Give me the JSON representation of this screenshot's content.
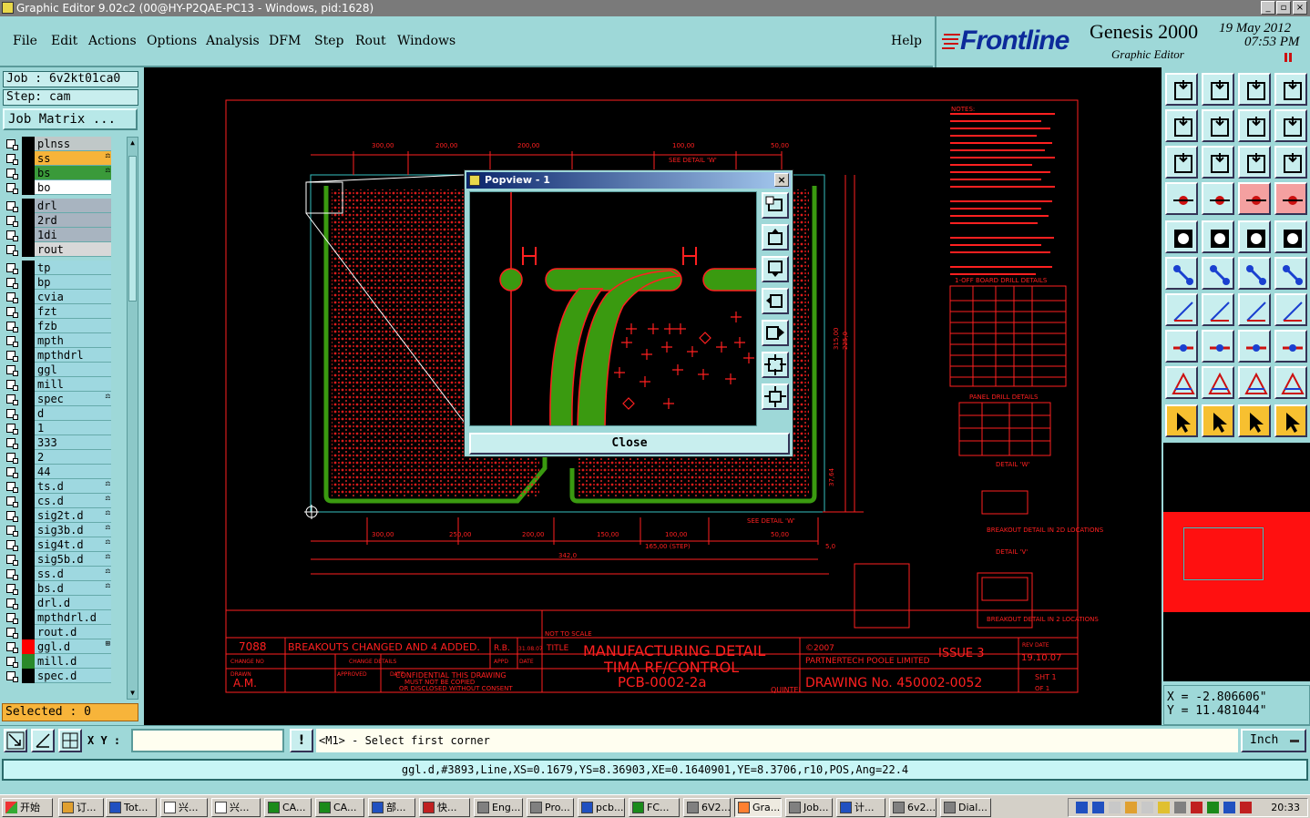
{
  "window": {
    "title": "Graphic Editor 9.02c2 (00@HY-P2QAE-PC13 - Windows, pid:1628)"
  },
  "menu": {
    "items": [
      "File",
      "Edit",
      "Actions",
      "Options",
      "Analysis",
      "DFM",
      "Step",
      "Rout",
      "Windows"
    ],
    "help": "Help"
  },
  "brand": {
    "logo": "Frontline",
    "product": "Genesis 2000",
    "subtitle": "Graphic Editor",
    "date": "19 May 2012",
    "time": "07:53 PM"
  },
  "job": {
    "job_label": "Job : 6v2kt01ca0",
    "step_label": "Step: cam",
    "matrix_button": "Job Matrix ..."
  },
  "layers": [
    {
      "name": "plnss",
      "color": "#000000",
      "bg": "#c0c8c8",
      "mark": ""
    },
    {
      "name": "ss",
      "color": "#000000",
      "bg": "#f7b43a",
      "mark": "⚖"
    },
    {
      "name": "bs",
      "color": "#000000",
      "bg": "#3a9a3a",
      "mark": "⚖"
    },
    {
      "name": "bo",
      "color": "#000000",
      "bg": "#ffffff",
      "mark": ""
    },
    {
      "name": "drl",
      "color": "#000000",
      "bg": "#a8b4c0",
      "mark": ""
    },
    {
      "name": "2rd",
      "color": "#000000",
      "bg": "#a8b4c0",
      "mark": ""
    },
    {
      "name": "1di",
      "color": "#000000",
      "bg": "#a8b4c0",
      "mark": ""
    },
    {
      "name": "rout",
      "color": "#000000",
      "bg": "#d8d8d8",
      "mark": ""
    },
    {
      "name": "tp",
      "color": "#000000",
      "bg": "#9ed8e0",
      "mark": ""
    },
    {
      "name": "bp",
      "color": "#000000",
      "bg": "#9ed8e0",
      "mark": ""
    },
    {
      "name": "cvia",
      "color": "#000000",
      "bg": "#9ed8e0",
      "mark": ""
    },
    {
      "name": "fzt",
      "color": "#000000",
      "bg": "#9ed8e0",
      "mark": ""
    },
    {
      "name": "fzb",
      "color": "#000000",
      "bg": "#9ed8e0",
      "mark": ""
    },
    {
      "name": "mpth",
      "color": "#000000",
      "bg": "#9ed8e0",
      "mark": ""
    },
    {
      "name": "mpthdrl",
      "color": "#000000",
      "bg": "#9ed8e0",
      "mark": ""
    },
    {
      "name": "ggl",
      "color": "#000000",
      "bg": "#9ed8e0",
      "mark": ""
    },
    {
      "name": "mill",
      "color": "#000000",
      "bg": "#9ed8e0",
      "mark": ""
    },
    {
      "name": "spec",
      "color": "#000000",
      "bg": "#9ed8e0",
      "mark": "⚖"
    },
    {
      "name": "d",
      "color": "#000000",
      "bg": "#9ed8e0",
      "mark": ""
    },
    {
      "name": "1",
      "color": "#000000",
      "bg": "#9ed8e0",
      "mark": ""
    },
    {
      "name": "333",
      "color": "#000000",
      "bg": "#9ed8e0",
      "mark": ""
    },
    {
      "name": "2",
      "color": "#000000",
      "bg": "#9ed8e0",
      "mark": ""
    },
    {
      "name": "44",
      "color": "#000000",
      "bg": "#9ed8e0",
      "mark": ""
    },
    {
      "name": "ts.d",
      "color": "#000000",
      "bg": "#9ed8e0",
      "mark": "⚖"
    },
    {
      "name": "cs.d",
      "color": "#000000",
      "bg": "#9ed8e0",
      "mark": "⚖"
    },
    {
      "name": "sig2t.d",
      "color": "#000000",
      "bg": "#9ed8e0",
      "mark": "⚖"
    },
    {
      "name": "sig3b.d",
      "color": "#000000",
      "bg": "#9ed8e0",
      "mark": "⚖"
    },
    {
      "name": "sig4t.d",
      "color": "#000000",
      "bg": "#9ed8e0",
      "mark": "⚖"
    },
    {
      "name": "sig5b.d",
      "color": "#000000",
      "bg": "#9ed8e0",
      "mark": "⚖"
    },
    {
      "name": "ss.d",
      "color": "#000000",
      "bg": "#9ed8e0",
      "mark": "⚖"
    },
    {
      "name": "bs.d",
      "color": "#000000",
      "bg": "#9ed8e0",
      "mark": "⚖"
    },
    {
      "name": "drl.d",
      "color": "#000000",
      "bg": "#9ed8e0",
      "mark": ""
    },
    {
      "name": "mpthdrl.d",
      "color": "#000000",
      "bg": "#9ed8e0",
      "mark": ""
    },
    {
      "name": "rout.d",
      "color": "#000000",
      "bg": "#9ed8e0",
      "mark": ""
    },
    {
      "name": "ggl.d",
      "color": "#ff0000",
      "bg": "#9ed8e0",
      "mark": "⊞"
    },
    {
      "name": "mill.d",
      "color": "#2a8a2a",
      "bg": "#9ed8e0",
      "mark": ""
    },
    {
      "name": "spec.d",
      "color": "#000000",
      "bg": "#9ed8e0",
      "mark": ""
    }
  ],
  "selected": {
    "label": "Selected : 0"
  },
  "popview": {
    "title": "Popview - 1",
    "close_label": "Close"
  },
  "coords": {
    "x": "X = -2.806606\"",
    "y": "Y = 11.481044\""
  },
  "command": {
    "xy_label": "X Y :",
    "xy_value": "",
    "prompt": "<M1> - Select first corner",
    "units": "Inch"
  },
  "status": {
    "text": "ggl.d,#3893,Line,XS=0.1679,YS=8.36903,XE=0.1640901,YE=8.3706,r10,POS,Ang=22.4"
  },
  "drawing": {
    "dims_top": [
      "300,00",
      "200,00",
      "200,00",
      "100,00",
      "50,00"
    ],
    "dims_bottom": [
      "300,00",
      "250,00",
      "200,00",
      "150,00",
      "100,00",
      "50,00"
    ],
    "see_detail_w": "SEE DETAIL 'W'",
    "see_detail_v": "SEE DETAIL 'W'",
    "step_dim": "165,00 (STEP)",
    "overall_dim": "342,0",
    "side_dims": [
      "315,00",
      "225,0",
      "37,64",
      "5,0"
    ],
    "title_block": {
      "rev": "7088",
      "change_text": "BREAKOUTS CHANGED AND 4 ADDED.",
      "rb": "R.B.",
      "rb_date": "31.08.07",
      "not_to_scale": "NOT TO SCALE",
      "title_label": "TITLE",
      "title_lines": [
        "MANUFACTURING DETAIL",
        "TIMA RF/CONTROL",
        "PCB-0002-2a"
      ],
      "copyright": "©2007",
      "company": "PARTNERTECH POOLE LIMITED",
      "issue": "ISSUE 3",
      "date": "19.10.07",
      "drawn_by": "A.M.",
      "confidential": [
        "CONFIDENTIAL THIS DRAWING",
        "MUST NOT BE COPIED",
        "OR DISCLOSED WITHOUT CONSENT"
      ],
      "drawing_no": "DRAWING No. 450002-0052",
      "quintel": "QUINTEL",
      "sht": "SHT 1",
      "of": "OF 1",
      "labels": {
        "change_no": "CHANGE NO",
        "change_details": "CHANGE DETAILS",
        "appd": "APPD",
        "date": "DATE",
        "drawn": "DRAWN",
        "approved": "APPROVED",
        "rev_date": "REV DATE"
      }
    },
    "notes_title": "NOTES:",
    "table1_title": "1-OFF BOARD DRILL DETAILS",
    "table2_title": "PANEL DRILL DETAILS",
    "detail_w": "DETAIL 'W'",
    "detail_v": "DETAIL 'V'",
    "breakout_1": "BREAKOUT DETAIL IN 2D LOCATIONS",
    "breakout_2": "BREAKOUT DETAIL IN 2 LOCATIONS"
  },
  "taskbar": {
    "start": "开始",
    "tasks": [
      "订...",
      "Tot...",
      "兴...",
      "兴...",
      "CA...",
      "CA...",
      "部...",
      "快...",
      "Eng...",
      "Pro...",
      "pcb...",
      "FC...",
      "6V2...",
      "Gra...",
      "Job...",
      "计...",
      "6v2...",
      "Dial..."
    ],
    "clock": "20:33"
  },
  "colors": {
    "bg_teal": "#9ed8d8",
    "canvas": "#000000",
    "drawing_red": "#ff2020",
    "board_green": "#3a9a10",
    "accent_orange": "#f7b43a",
    "brand_red": "#cc1010"
  }
}
